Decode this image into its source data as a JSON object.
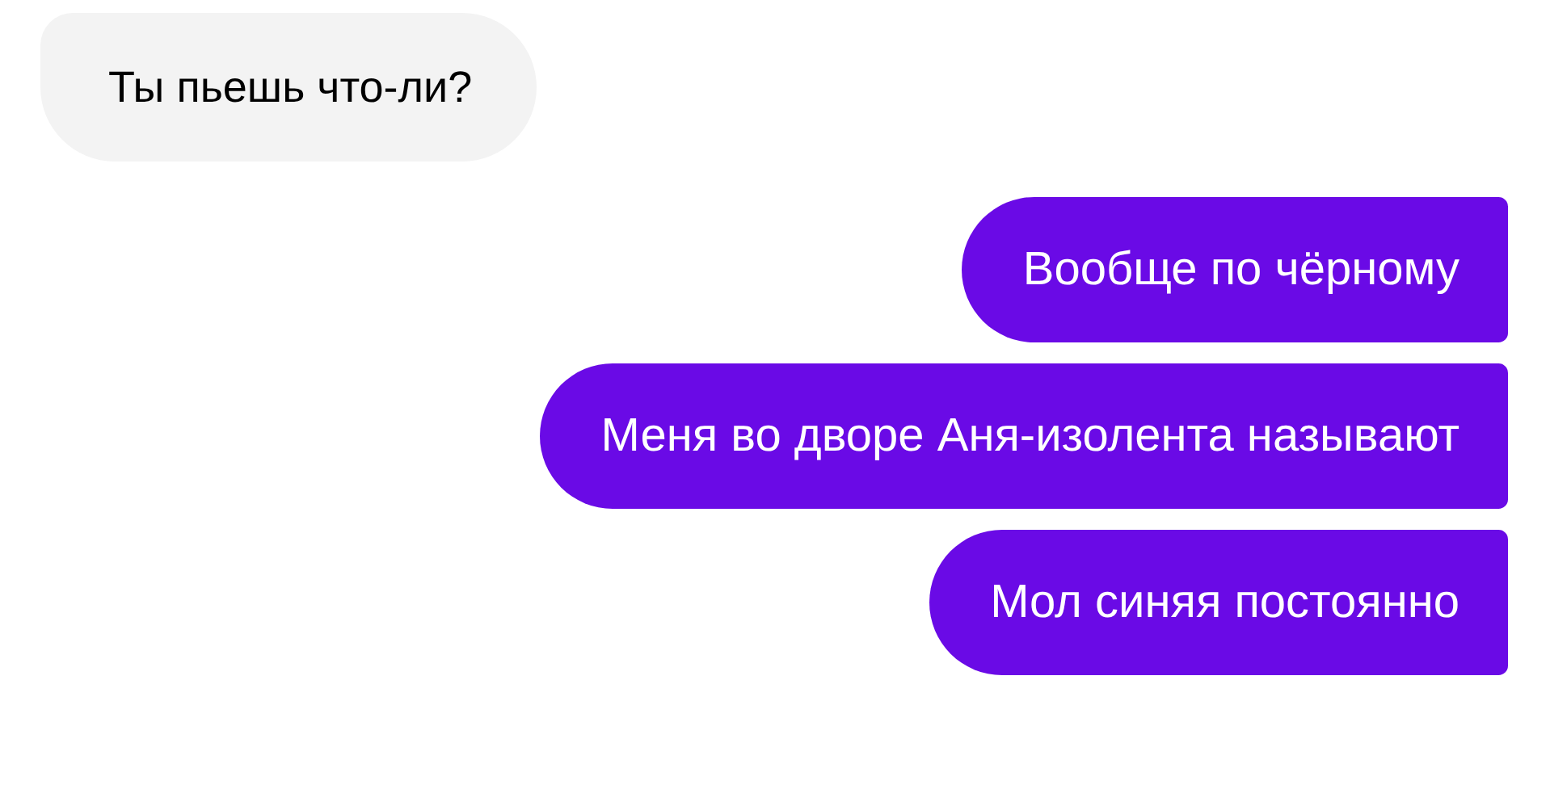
{
  "messages": [
    {
      "kind": "received",
      "text": "Ты пьешь что-ли?"
    },
    {
      "kind": "sent",
      "text": "Вообще по чёрному"
    },
    {
      "kind": "sent",
      "text": "Меня во дворе Аня-изолента называют"
    },
    {
      "kind": "sent",
      "text": "Мол синяя постоянно"
    }
  ]
}
